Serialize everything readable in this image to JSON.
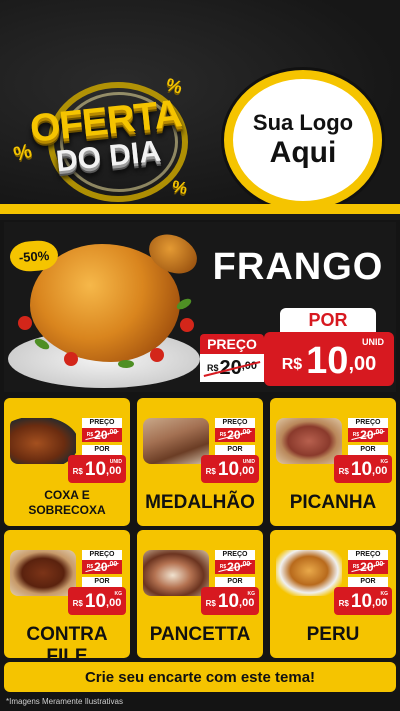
{
  "header": {
    "badge_line1": "OFERTA",
    "badge_line2": "DO DIA",
    "percent_symbol": "%",
    "logo_line1": "Sua Logo",
    "logo_line2": "Aqui"
  },
  "featured": {
    "discount": "-50%",
    "name": "FRANGO",
    "preco_label": "PREÇO",
    "por_label": "POR",
    "old_price": {
      "currency": "R$",
      "integer": "20",
      "cents": ",00"
    },
    "new_price": {
      "currency": "R$",
      "integer": "10",
      "cents": ",00",
      "unit": "UNID"
    }
  },
  "products": [
    {
      "name": "COXA E SOBRECOXA",
      "preco_label": "PREÇO",
      "por_label": "POR",
      "old_currency": "R$",
      "old_integer": "20",
      "old_cents": ",00",
      "currency": "R$",
      "integer": "10",
      "cents": ",00",
      "unit": "UNID"
    },
    {
      "name": "MEDALHÃO",
      "preco_label": "PREÇO",
      "por_label": "POR",
      "old_currency": "R$",
      "old_integer": "20",
      "old_cents": ",00",
      "currency": "R$",
      "integer": "10",
      "cents": ",00",
      "unit": "UNID"
    },
    {
      "name": "PICANHA",
      "preco_label": "PREÇO",
      "por_label": "POR",
      "old_currency": "R$",
      "old_integer": "20",
      "old_cents": ",00",
      "currency": "R$",
      "integer": "10",
      "cents": ",00",
      "unit": "KG"
    },
    {
      "name": "CONTRA FILE",
      "preco_label": "PREÇO",
      "por_label": "POR",
      "old_currency": "R$",
      "old_integer": "20",
      "old_cents": ",00",
      "currency": "R$",
      "integer": "10",
      "cents": ",00",
      "unit": "KG"
    },
    {
      "name": "PANCETTA",
      "preco_label": "PREÇO",
      "por_label": "POR",
      "old_currency": "R$",
      "old_integer": "20",
      "old_cents": ",00",
      "currency": "R$",
      "integer": "10",
      "cents": ",00",
      "unit": "KG"
    },
    {
      "name": "PERU",
      "preco_label": "PREÇO",
      "por_label": "POR",
      "old_currency": "R$",
      "old_integer": "20",
      "old_cents": ",00",
      "currency": "R$",
      "integer": "10",
      "cents": ",00",
      "unit": "KG"
    }
  ],
  "footer": {
    "cta": "Crie seu encarte com este tema!",
    "disclaimer": "*Imagens Meramente Ilustrativas"
  },
  "colors": {
    "brand_yellow": "#f5c400",
    "price_red": "#d71920",
    "background": "#141414"
  }
}
